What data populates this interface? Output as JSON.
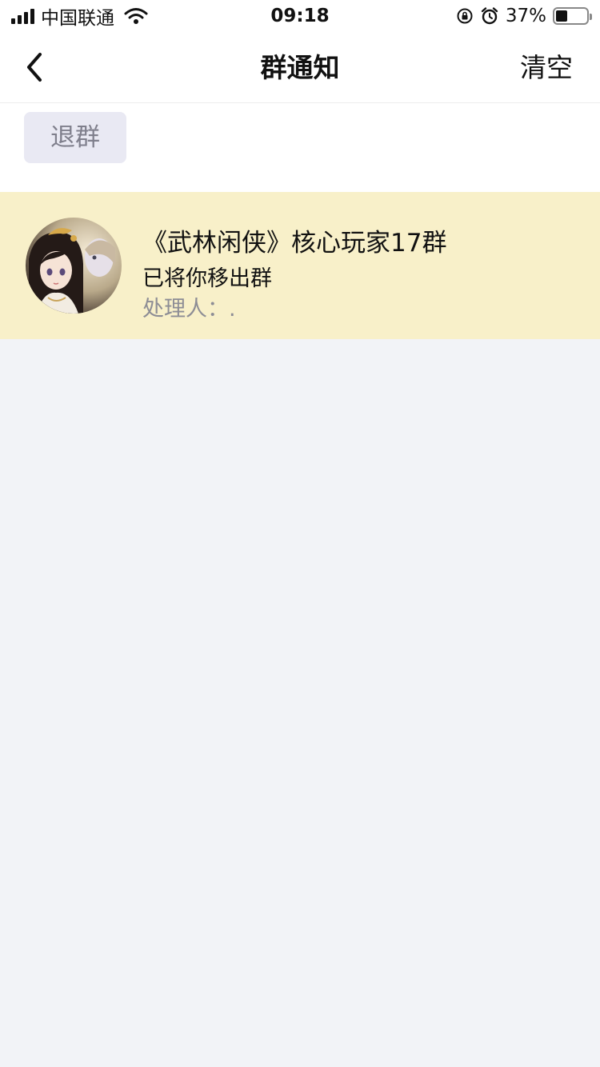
{
  "status_bar": {
    "carrier": "中国联通",
    "time": "09:18",
    "battery_percent": "37%",
    "battery_level": 0.37
  },
  "nav": {
    "title": "群通知",
    "clear_label": "清空"
  },
  "actions": {
    "quit_label": "退群"
  },
  "notification": {
    "group_name": "《武林闲侠》核心玩家17群",
    "message": "已将你移出群",
    "handler": "处理人：."
  },
  "colors": {
    "card_background": "#f8f0c9",
    "page_background": "#f2f3f7",
    "button_background": "#e9e9f3"
  }
}
